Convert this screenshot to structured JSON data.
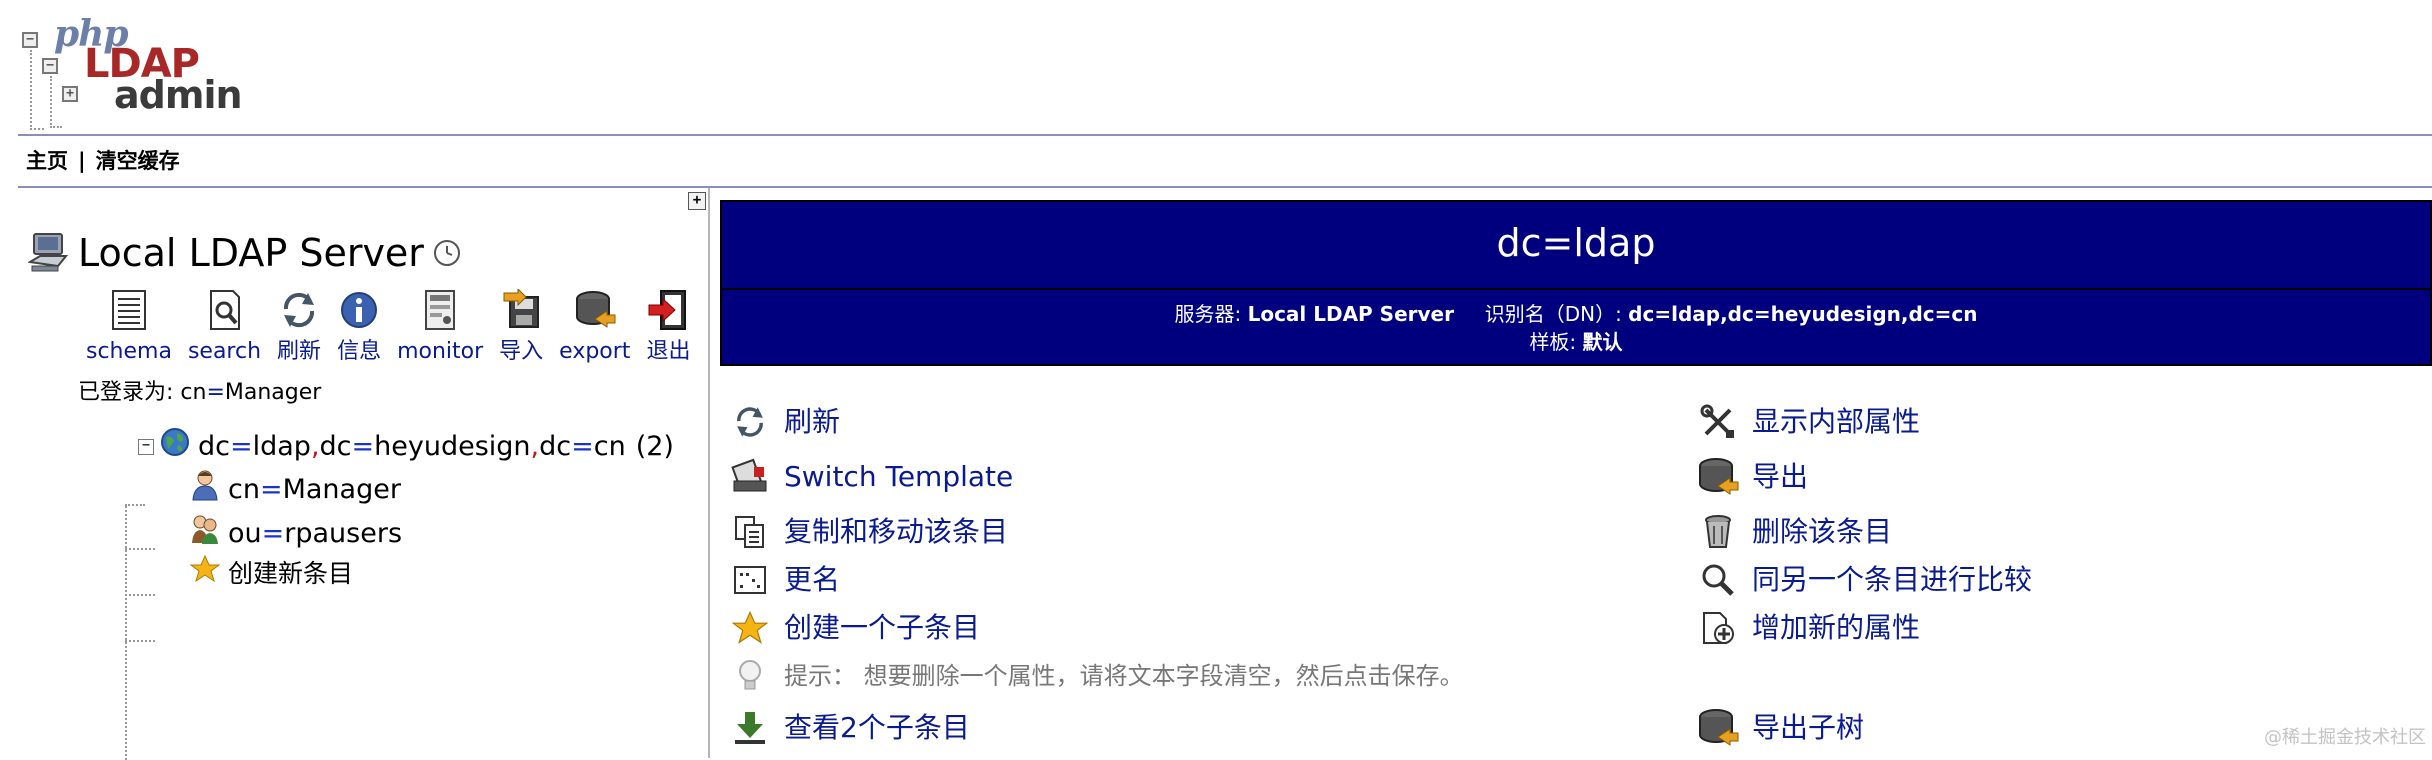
{
  "logo": {
    "php": "php",
    "ldap": "LDAP",
    "admin": "admin"
  },
  "nav": {
    "home": "主页",
    "separator": "|",
    "purge": "清空缓存"
  },
  "tree": {
    "expand_symbol": "+",
    "server_name": "Local LDAP Server",
    "menu": [
      {
        "label": "schema",
        "icon": "schema-icon"
      },
      {
        "label": "search",
        "icon": "search-icon"
      },
      {
        "label": "刷新",
        "icon": "refresh-icon"
      },
      {
        "label": "信息",
        "icon": "info-icon"
      },
      {
        "label": "monitor",
        "icon": "monitor-icon"
      },
      {
        "label": "导入",
        "icon": "import-icon"
      },
      {
        "label": "export",
        "icon": "export-icon"
      },
      {
        "label": "退出",
        "icon": "logout-icon"
      }
    ],
    "logged_in": {
      "prefix": "已登录为: ",
      "attr": "cn",
      "eq": "=",
      "value": "Manager"
    },
    "root": {
      "toggle": "−",
      "parts": [
        {
          "attr": "dc",
          "value": "ldap"
        },
        {
          "attr": "dc",
          "value": "heyudesign"
        },
        {
          "attr": "dc",
          "value": "cn"
        }
      ],
      "eq": "=",
      "comma": ",",
      "count": "(2)"
    },
    "children": [
      {
        "attr": "cn",
        "value": "Manager",
        "icon": "user-icon"
      },
      {
        "attr": "ou",
        "value": "rpausers",
        "icon": "group-icon"
      }
    ],
    "create_new": "创建新条目"
  },
  "entry": {
    "dn_title": "dc=ldap",
    "server_label": "服务器: ",
    "server_value": "Local LDAP Server",
    "dn_label": "识别名（DN）: ",
    "dn_value": "dc=ldap,dc=heyudesign,dc=cn",
    "template_label": "样板: ",
    "template_value": "默认"
  },
  "actions": {
    "left": [
      {
        "label": "刷新",
        "icon": "refresh-icon"
      },
      {
        "label": "Switch Template",
        "icon": "switch-template-icon"
      },
      {
        "label": "复制和移动该条目",
        "icon": "copy-icon"
      },
      {
        "label": "更名",
        "icon": "rename-icon"
      },
      {
        "label": "创建一个子条目",
        "icon": "star-icon"
      },
      {
        "label": "提示：  想要删除一个属性，请将文本字段清空，然后点击保存。",
        "icon": "lightbulb-icon"
      },
      {
        "label": "查看2个子条目",
        "icon": "download-arrow-icon"
      }
    ],
    "right": [
      {
        "label": "显示内部属性",
        "icon": "tools-icon"
      },
      {
        "label": "导出",
        "icon": "export-icon"
      },
      {
        "label": "删除该条目",
        "icon": "trash-icon"
      },
      {
        "label": "同另一个条目进行比较",
        "icon": "compare-icon"
      },
      {
        "label": "增加新的属性",
        "icon": "add-attribute-icon"
      },
      {
        "label": "导出子树",
        "icon": "export-subtree-icon"
      }
    ]
  },
  "watermark": "@稀土掘金技术社区",
  "colors": {
    "header_bg": "#00007e",
    "link": "#0a1b8f",
    "rule": "#8a8fb8"
  }
}
